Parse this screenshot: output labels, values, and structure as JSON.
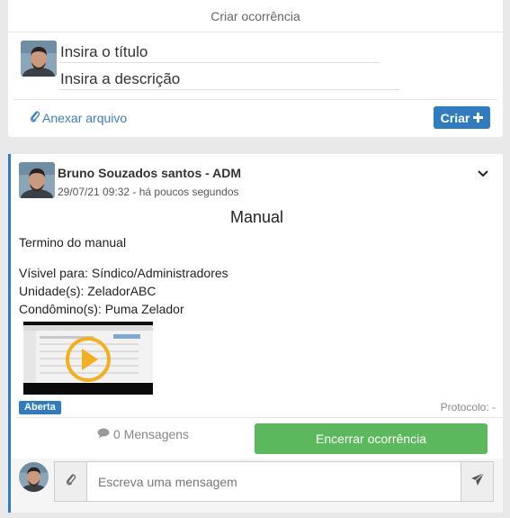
{
  "create": {
    "header": "Criar ocorrência",
    "title_placeholder": "Insira o título",
    "description_placeholder": "Insira a descrição",
    "attach_label": "Anexar arquivo",
    "create_label": "Criar"
  },
  "post": {
    "author": "Bruno Souzados santos - ADM",
    "timestamp": "29/07/21 09:32 - há poucos segundos",
    "title": "Manual",
    "body": "Termino do manual",
    "visible_for": "Vísivel para: Síndico/Administradores",
    "units": "Unidade(s): ZeladorABC",
    "residents": "Condômino(s): Puma Zelador",
    "status": "Aberta",
    "protocol": "Protocolo: -",
    "messages": "0 Mensagens",
    "close_label": "Encerrar ocorrência",
    "message_placeholder": "Escreva uma mensagem"
  },
  "colors": {
    "primary": "#2f7cc0",
    "success": "#5cb85c",
    "play_accent": "#f2b01e"
  },
  "icons": [
    "paperclip-icon",
    "plus-icon",
    "chevron-down-icon",
    "comment-icon",
    "play-icon",
    "send-icon"
  ]
}
